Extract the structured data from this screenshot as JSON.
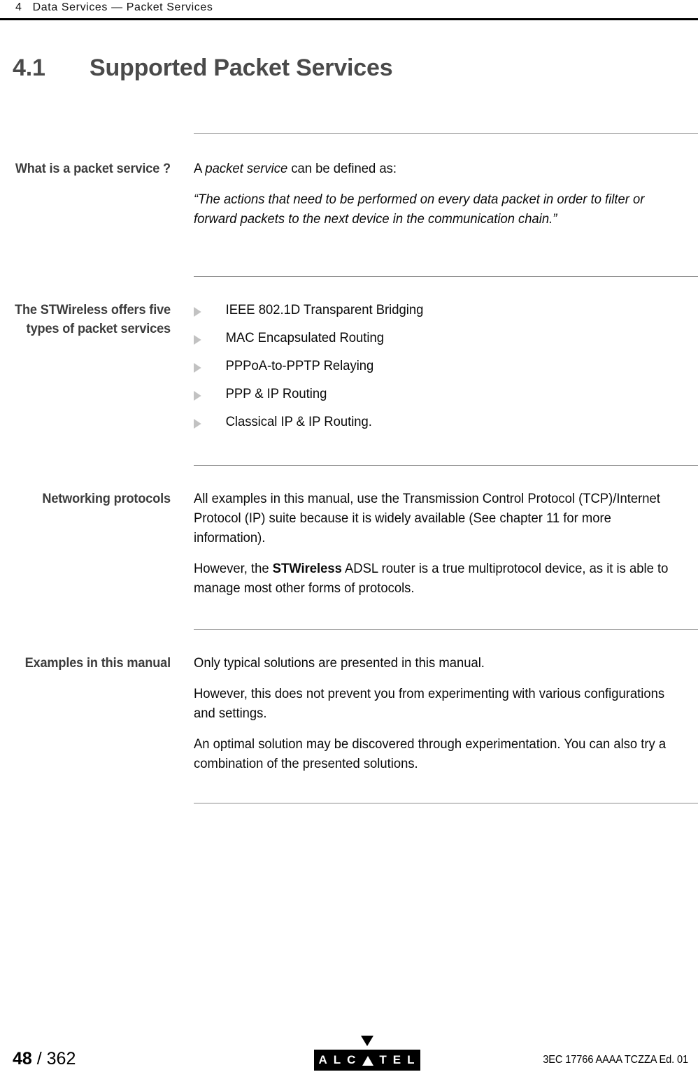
{
  "header": {
    "chapter_number": "4",
    "chapter_title": "Data Services — Packet Services",
    "running_head": "4   Data Services — Packet Services"
  },
  "title": {
    "number": "4.1",
    "text": "Supported Packet Services"
  },
  "sections": [
    {
      "label": "What is a packet service ?",
      "paragraphs": [
        "A packet service can be defined as:",
        "“The actions that need to be performed on every data packet in order to filter or forward packets to the next device in the communication chain.”"
      ],
      "intro_lead": "A ",
      "intro_italic": "packet service",
      "intro_tail": " can be defined as:",
      "quote": "“The actions that need to be performed on every data packet in order to filter or forward packets to the next device in the communication chain.”"
    },
    {
      "label": "The STWireless offers five types of packet services",
      "bullets": [
        "IEEE 802.1D Transparent Bridging",
        "MAC Encapsulated Routing",
        "PPPoA-to-PPTP Relaying",
        "PPP & IP Routing",
        "Classical IP & IP Routing."
      ]
    },
    {
      "label": "Networking protocols",
      "para1": "All examples in this manual, use the Transmission Control Protocol (TCP)/Internet Protocol (IP) suite because it is widely available (See chapter 11 for more information).",
      "para2_lead": "However, the ",
      "para2_bold": "STWireless",
      "para2_tail": " ADSL router is a true multiprotocol device, as it is able to manage most other forms of protocols."
    },
    {
      "label": "Examples in this manual",
      "para1": "Only typical solutions are presented in this manual.",
      "para2": "However, this does not prevent you from experimenting with various configurations and settings.",
      "para3": "An optimal solution may be discovered through experimentation. You can also try a combination of the presented solutions."
    }
  ],
  "footer": {
    "page_current": "48",
    "page_separator": " / ",
    "page_total": "362",
    "document_reference": "3EC 17766 AAAA TCZZA Ed. 01",
    "logo": {
      "name": "ALCATEL",
      "letters": [
        "A",
        "L",
        "C",
        "▲",
        "T",
        "E",
        "L"
      ],
      "l1": "A",
      "l2": "L",
      "l3": "C",
      "l5": "T",
      "l6": "E",
      "l7": "L"
    }
  },
  "colors": {
    "title_gray": "#4a4a4a",
    "label_gray": "#3c3c3c",
    "rule_gray": "#8a8a8a",
    "bullet_gray": "#c2c2c2",
    "ink": "#000000"
  }
}
